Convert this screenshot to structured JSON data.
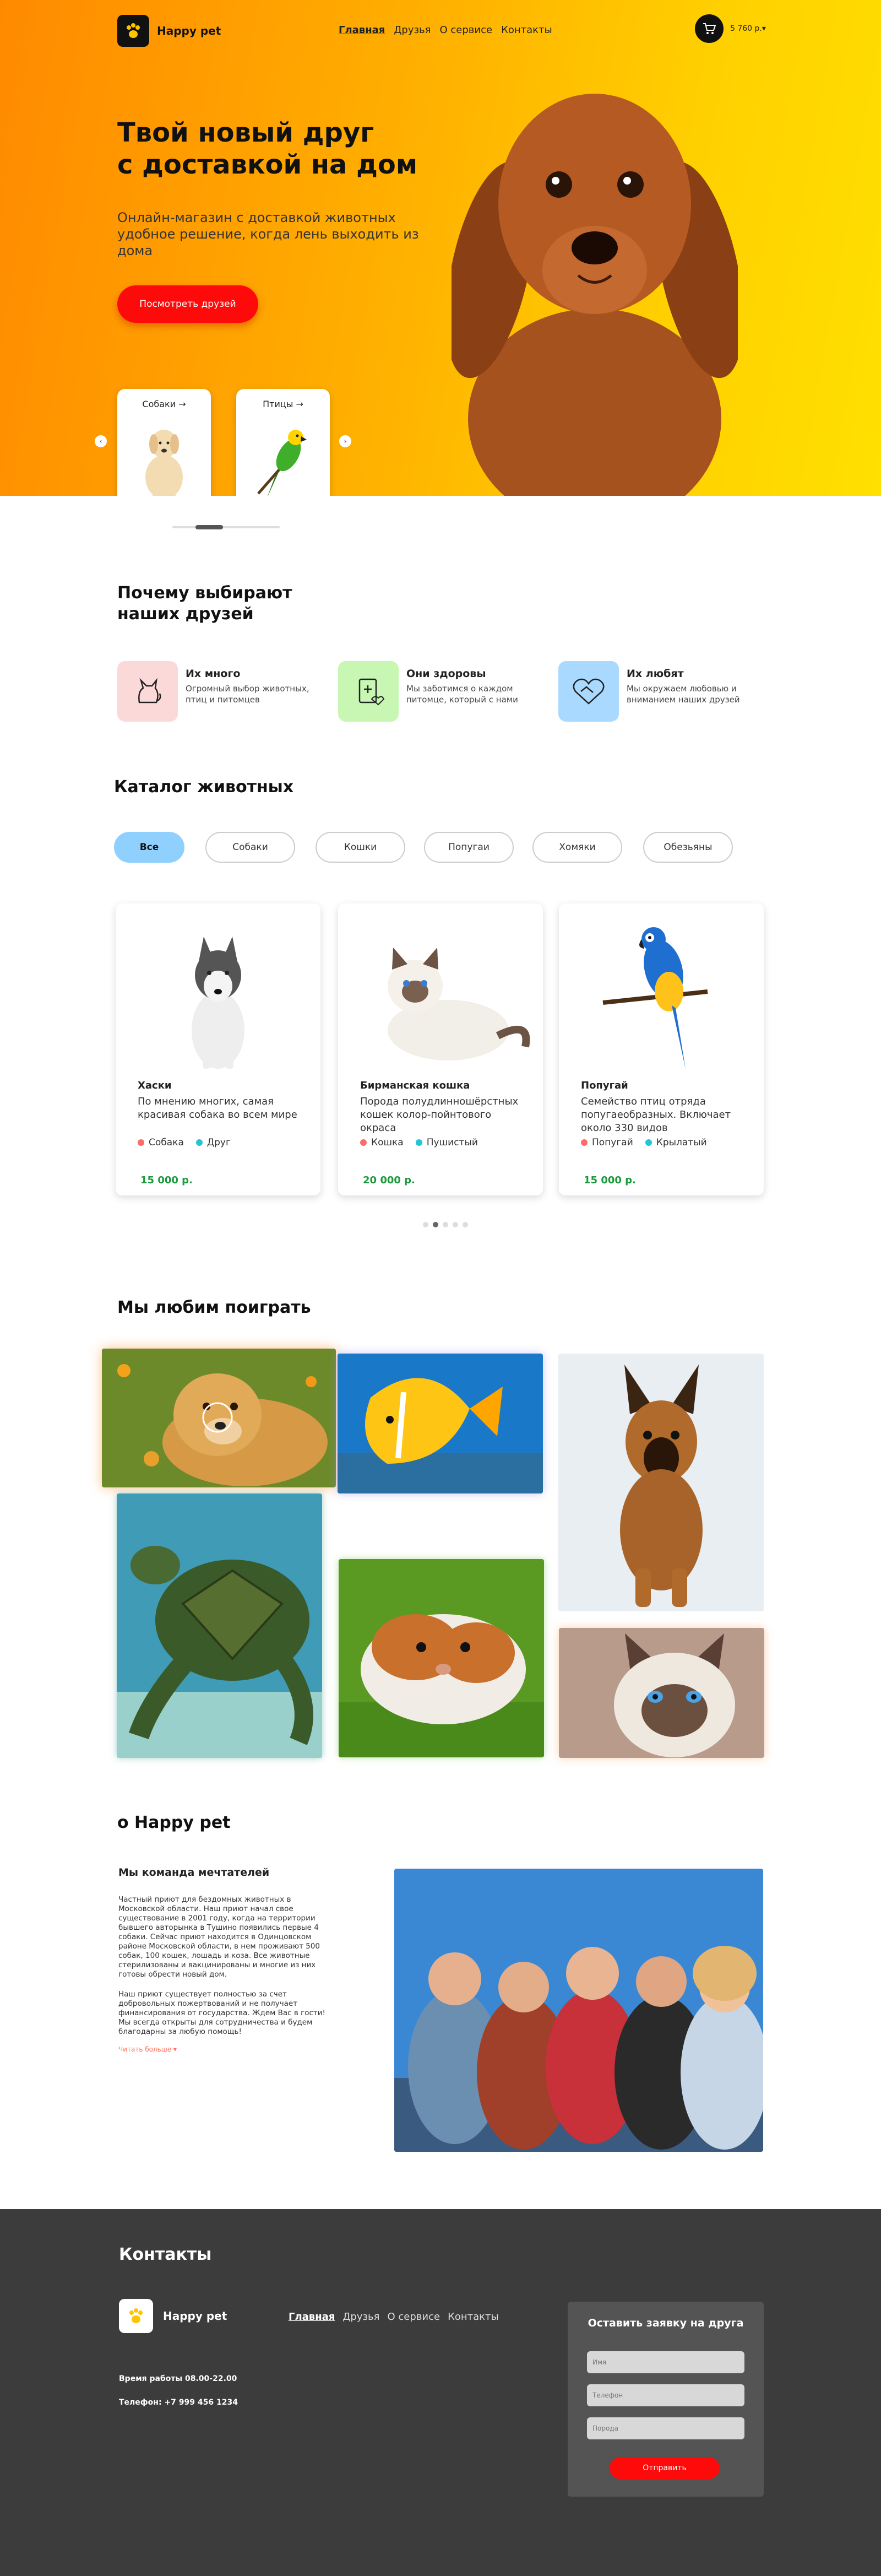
{
  "header": {
    "logo_text": "Happy pet",
    "nav": [
      "Главная",
      "Друзья",
      "О сервисе",
      "Контакты"
    ],
    "cart_sum": "5 760 р.▾"
  },
  "hero": {
    "title_line1": "Твой новый друг",
    "title_line2": "с доставкой на дом",
    "subtitle": "Онлайн-магазин с доставкой животных удобное решение, когда лень выходить из дома",
    "button": "Посмотреть друзей",
    "categories": [
      {
        "label": "Собаки →",
        "icon": "dog-icon"
      },
      {
        "label": "Птицы →",
        "icon": "bird-icon"
      }
    ]
  },
  "why": {
    "title_line1": "Почему выбирают",
    "title_line2": "наших друзей",
    "features": [
      {
        "title": "Их много",
        "desc": "Огромный выбор животных, птиц и питомцев",
        "icon": "cat-icon",
        "color": "#fcd9d9"
      },
      {
        "title": "Они здоровы",
        "desc": "Мы заботимся о каждом питомце, который с нами",
        "icon": "health-icon",
        "color": "#c7f7b2"
      },
      {
        "title": "Их любят",
        "desc": "Мы окружаем любовью и вниманием наших друзей",
        "icon": "handshake-icon",
        "color": "#a9d9ff"
      }
    ]
  },
  "catalog": {
    "title": "Каталог животных",
    "filters": [
      "Все",
      "Собаки",
      "Кошки",
      "Попугаи",
      "Хомяки",
      "Обезьяны"
    ],
    "items": [
      {
        "name": "Хаски",
        "desc": "По мнению многих, самая красивая собака во всем мире",
        "tags": [
          "Собака",
          "Друг"
        ],
        "price": "15 000 р."
      },
      {
        "name": "Бирманская кошка",
        "desc": "Порода полудлинношёрстных кошек колор-пойнтового окраса",
        "tags": [
          "Кошка",
          "Пушистый"
        ],
        "price": "20 000 р."
      },
      {
        "name": "Попугай",
        "desc": "Семейство птиц отряда попугаеобразных. Включает около 330 видов",
        "tags": [
          "Попугай",
          "Крылатый"
        ],
        "price": "15 000 р."
      }
    ]
  },
  "gallery": {
    "title": "Мы любим поиграть",
    "tiles": [
      "golden-retriever",
      "butterflyfish",
      "shepherd-puppy",
      "sea-turtle",
      "guinea-pig",
      "birman-cat"
    ]
  },
  "about": {
    "title": "о Happy pet",
    "subtitle": "Мы команда мечтателей",
    "p1": "Частный приют для бездомных животных в Московской области. Наш приют начал свое существование в 2001 году, когда на территории бывшего авторынка в Тушино появились первые 4 собаки. Сейчас приют находится в Одинцовском районе Московской области, в нем проживают 500 собак, 100 кошек, лошадь и коза. Все животные стерилизованы и вакцинированы и многие из них готовы обрести новый дом.",
    "p2": "Наш приют существует полностью за счет добровольных пожертвований и не получает финансирования от государства. Ждем Вас в гости! Мы всегда открыты для сотрудничества и будем благодарны за любую помощь!",
    "more": "Читать больше ▾"
  },
  "footer": {
    "title": "Контакты",
    "logo_text": "Happy pet",
    "nav": [
      "Главная",
      "Друзья",
      "О сервисе",
      "Контакты"
    ],
    "hours": "Время работы 08.00-22.00",
    "phone": "Телефон: +7 999 456 1234",
    "form": {
      "title": "Оставить заявку на друга",
      "name_ph": "Имя",
      "phone_ph": "Телефон",
      "pet_ph": "Порода",
      "button": "Отправить"
    }
  },
  "colors": {
    "accent": "#ff0a0a",
    "price": "#1a9a3c",
    "filter_active": "#8fd0ff",
    "footer_bg": "#3c3c3c"
  }
}
